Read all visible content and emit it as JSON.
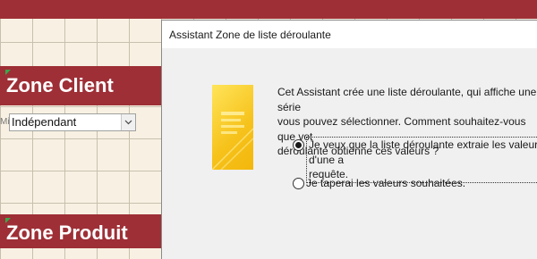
{
  "form": {
    "section_client": "Zone Client",
    "section_produit": "Zone Produit",
    "combo_label": "Mi",
    "combo_value": "Indépendant",
    "band_color": "#9e2f36",
    "grid_background": "#f8f1e3"
  },
  "dialog": {
    "title": "Assistant Zone de liste déroulante",
    "intro": "Cet Assistant crée une liste déroulante, qui affiche une série\nvous pouvez sélectionner. Comment souhaitez-vous que vot\ndéroulante obtienne ces valeurs ?",
    "options": [
      {
        "label": "Je veux que la liste déroulante extraie les valeurs d'une a\nrequête.",
        "selected": true
      },
      {
        "label": "Je taperai les valeurs souhaitées.",
        "selected": false
      }
    ],
    "illustration_icon": "list-illustration-icon"
  }
}
